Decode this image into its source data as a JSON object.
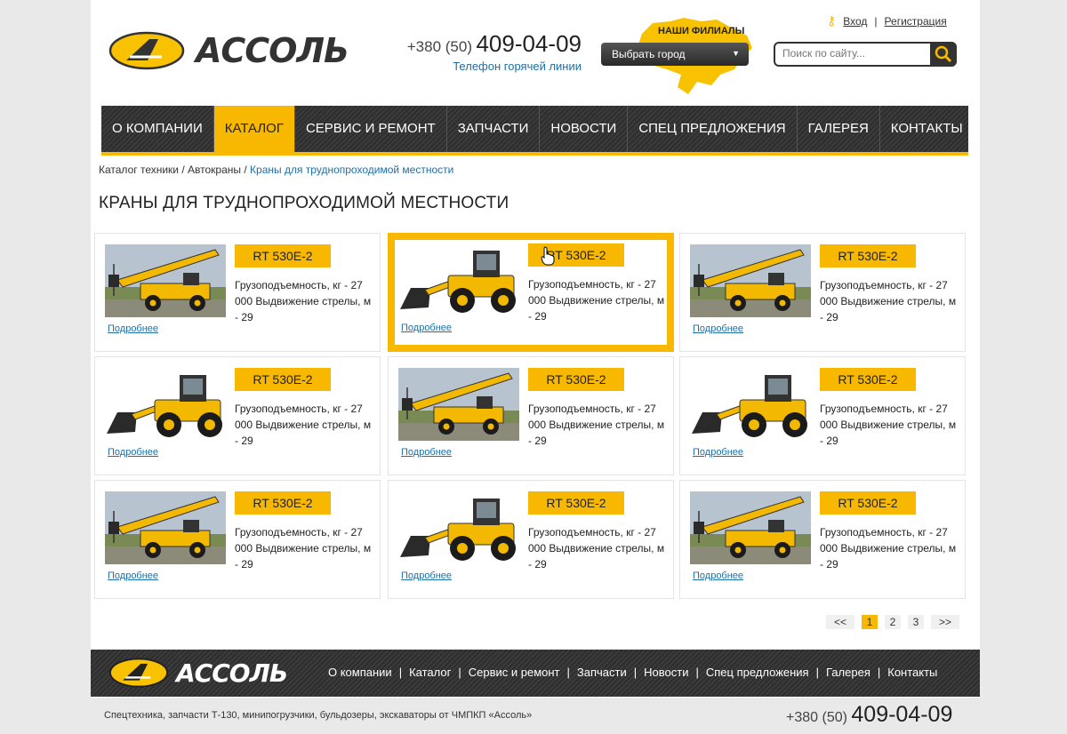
{
  "header": {
    "logo_text": "АССОЛЬ",
    "phone_code": "+380 (50)",
    "phone_number": "409-04-09",
    "hotline_label": "Телефон горячей линии",
    "branches_label": "НАШИ ФИЛИАЛЫ",
    "city_select": "Выбрать город",
    "login_label": "Вход",
    "register_label": "Регистрация",
    "search_placeholder": "Поиск по сайту..."
  },
  "nav": {
    "items": [
      {
        "label": "О КОМПАНИИ"
      },
      {
        "label": "КАТАЛОГ"
      },
      {
        "label": "СЕРВИС И РЕМОНТ"
      },
      {
        "label": "ЗАПЧАСТИ"
      },
      {
        "label": "НОВОСТИ"
      },
      {
        "label": "СПЕЦ ПРЕДЛОЖЕНИЯ"
      },
      {
        "label": "ГАЛЕРЕЯ"
      },
      {
        "label": "КОНТАКТЫ"
      }
    ],
    "active_index": 1
  },
  "breadcrumb": {
    "items": [
      "Каталог техники",
      "Автокраны"
    ],
    "current": "Краны для труднопроходимой местности"
  },
  "page_title": "КРАНЫ ДЛЯ ТРУДНОПРОХОДИМОЙ МЕСТНОСТИ",
  "products": [
    {
      "model": "RT 530E-2",
      "spec": "Грузоподъемность, кг - 27 000 Выдвижение стрелы, м - 29",
      "more": "Подробнее",
      "image": "crane"
    },
    {
      "model": "RT 530E-2",
      "spec": "Грузоподъемность, кг - 27 000 Выдвижение стрелы, м - 29",
      "more": "Подробнее",
      "image": "loader"
    },
    {
      "model": "RT 530E-2",
      "spec": "Грузоподъемность, кг - 27 000 Выдвижение стрелы, м - 29",
      "more": "Подробнее",
      "image": "crane"
    },
    {
      "model": "RT 530E-2",
      "spec": "Грузоподъемность, кг - 27 000 Выдвижение стрелы, м - 29",
      "more": "Подробнее",
      "image": "loader"
    },
    {
      "model": "RT 530E-2",
      "spec": "Грузоподъемность, кг - 27 000 Выдвижение стрелы, м - 29",
      "more": "Подробнее",
      "image": "crane"
    },
    {
      "model": "RT 530E-2",
      "spec": "Грузоподъемность, кг - 27 000 Выдвижение стрелы, м - 29",
      "more": "Подробнее",
      "image": "loader"
    },
    {
      "model": "RT 530E-2",
      "spec": "Грузоподъемность, кг - 27 000 Выдвижение стрелы, м - 29",
      "more": "Подробнее",
      "image": "crane"
    },
    {
      "model": "RT 530E-2",
      "spec": "Грузоподъемность, кг - 27 000 Выдвижение стрелы, м - 29",
      "more": "Подробнее",
      "image": "loader"
    },
    {
      "model": "RT 530E-2",
      "spec": "Грузоподъемность, кг - 27 000 Выдвижение стрелы, м - 29",
      "more": "Подробнее",
      "image": "crane"
    }
  ],
  "highlighted_index": 1,
  "pagination": {
    "prev": "<<",
    "pages": [
      "1",
      "2",
      "3"
    ],
    "current": "1",
    "next": ">>"
  },
  "footer": {
    "logo_text": "АССОЛЬ",
    "nav": [
      "О компании",
      "Каталог",
      "Сервис и ремонт",
      "Запчасти",
      "Новости",
      "Спец предложения",
      "Галерея",
      "Контакты"
    ],
    "copyright": "Спецтехника, запчасти Т-130, минипогрузчики, бульдозеры, экскаваторы от ЧМПКП «Ассоль»",
    "phone_code": "+380 (50)",
    "phone_number": "409-04-09"
  },
  "colors": {
    "accent": "#f8b800",
    "nav_bg": "#333333",
    "link": "#1e6fa8"
  }
}
